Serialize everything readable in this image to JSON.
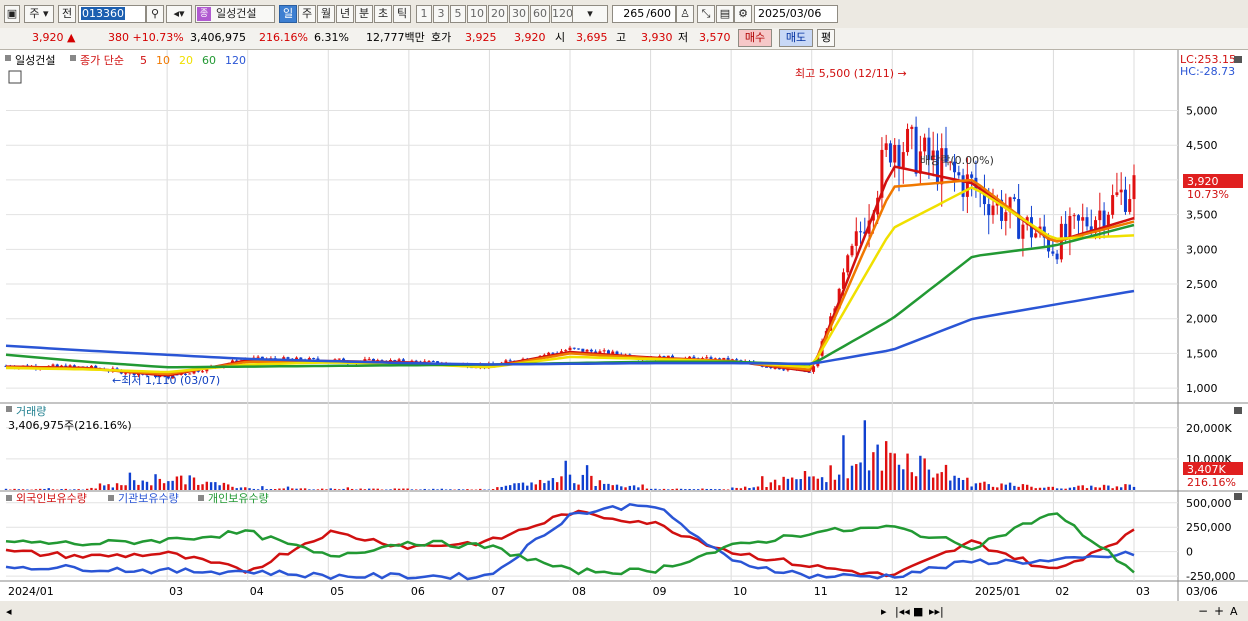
{
  "toolbar": {
    "type1": "주",
    "type2": "전",
    "code": "013360",
    "stock_name": "일성건설",
    "periods": [
      {
        "label": "일",
        "active": true
      },
      {
        "label": "주",
        "active": false
      },
      {
        "label": "월",
        "active": false
      },
      {
        "label": "년",
        "active": false
      },
      {
        "label": "분",
        "active": false
      },
      {
        "label": "초",
        "active": false
      },
      {
        "label": "틱",
        "active": false
      }
    ],
    "intervals": [
      "1",
      "3",
      "5",
      "10",
      "20",
      "30",
      "60",
      "120"
    ],
    "count": "265",
    "count_total": "/600",
    "date": "2025/03/06"
  },
  "quote": {
    "price": "3,920 ▲",
    "change": "380 +10.73%",
    "volume": "3,406,975",
    "vol_ratio": "216.16%",
    "turnover": "6.31%",
    "amount": "12,777백만",
    "hoga_label": "호가",
    "ask": "3,925",
    "bid": "3,920",
    "open_label": "시",
    "open": "3,695",
    "high_label": "고",
    "high": "3,930",
    "low_label": "저",
    "low": "3,570",
    "buy_btn": "매수",
    "sell_btn": "매도",
    "eval_btn": "평"
  },
  "price_panel": {
    "stock_label": "일성건설",
    "ma_label": "종가 단순",
    "ma_periods": [
      "5",
      "10",
      "20",
      "60",
      "120"
    ],
    "ma_colors": [
      "#d01010",
      "#f07800",
      "#f0e000",
      "#229933",
      "#2a55d5"
    ],
    "lc": "LC:253.15",
    "hc": "HC:-28.73",
    "high_annotation": "최고 5,500 (12/11) →",
    "low_annotation": "←최저 1,110 (03/07)",
    "ex_annotation": "배당락(0.00%)",
    "current_price": "3,920",
    "current_change": "10.73%"
  },
  "volume_panel": {
    "title": "거래량",
    "value": "3,406,975주(216.16%)",
    "current": "3,407K",
    "current_ratio": "216.16%"
  },
  "holding_panel": {
    "series": [
      {
        "name": "외국인보유수량",
        "color": "#d01010"
      },
      {
        "name": "기관보유수량",
        "color": "#2a55d5"
      },
      {
        "name": "개인보유수량",
        "color": "#229933"
      }
    ]
  },
  "xaxis": {
    "labels": [
      "2024/01",
      "03",
      "04",
      "05",
      "06",
      "07",
      "08",
      "09",
      "10",
      "11",
      "12",
      "2025/01",
      "02",
      "03"
    ],
    "end_label": "03/06"
  },
  "chart_data": [
    {
      "type": "candlestick",
      "title": "일성건설",
      "ylim": [
        800,
        5800
      ],
      "yticks": [
        1000,
        1500,
        2000,
        2500,
        3000,
        3500,
        4000,
        4500,
        5000
      ],
      "grid": true,
      "x": [
        "2024-01",
        "2024-02",
        "2024-03",
        "2024-04",
        "2024-05",
        "2024-06",
        "2024-07",
        "2024-08",
        "2024-09",
        "2024-10",
        "2024-11",
        "2024-12",
        "2025-01",
        "2025-02",
        "2025-03"
      ],
      "series": [
        {
          "name": "close",
          "values": [
            1320,
            1300,
            1160,
            1420,
            1400,
            1380,
            1320,
            1560,
            1440,
            1400,
            1220,
            4600,
            3900,
            3050,
            3920
          ]
        },
        {
          "name": "5",
          "values": [
            1310,
            1290,
            1180,
            1400,
            1390,
            1370,
            1310,
            1520,
            1440,
            1390,
            1240,
            4200,
            3950,
            3100,
            3450
          ]
        },
        {
          "name": "10",
          "values": [
            1300,
            1280,
            1200,
            1380,
            1380,
            1360,
            1300,
            1500,
            1430,
            1390,
            1260,
            3900,
            4000,
            3100,
            3400
          ]
        },
        {
          "name": "20",
          "values": [
            1290,
            1270,
            1230,
            1340,
            1370,
            1350,
            1300,
            1450,
            1420,
            1380,
            1300,
            3300,
            3900,
            3150,
            3200
          ]
        },
        {
          "name": "60",
          "values": [
            1480,
            1380,
            1300,
            1310,
            1320,
            1330,
            1340,
            1360,
            1380,
            1380,
            1340,
            2000,
            2900,
            3050,
            3350
          ]
        },
        {
          "name": "120",
          "values": [
            1610,
            1540,
            1480,
            1420,
            1390,
            1360,
            1340,
            1350,
            1360,
            1360,
            1350,
            1550,
            2000,
            2200,
            2400
          ]
        }
      ],
      "annotations": [
        {
          "text": "최고 5,500 (12/11)",
          "value": 5500
        },
        {
          "text": "최저 1,110 (03/07)",
          "value": 1110
        }
      ]
    },
    {
      "type": "bar",
      "title": "거래량",
      "ylim": [
        0,
        27000
      ],
      "yticks_labels": [
        "10,000K",
        "20,000K"
      ],
      "x": [
        "2024-01",
        "2024-02",
        "2024-03",
        "2024-04",
        "2024-05",
        "2024-06",
        "2024-07",
        "2024-08",
        "2024-09",
        "2024-10",
        "2024-11",
        "2024-12",
        "2025-01",
        "2025-02",
        "2025-03"
      ],
      "values": [
        600,
        500,
        9000,
        1200,
        800,
        700,
        500,
        9000,
        800,
        600,
        9500,
        26000,
        5000,
        1500,
        3407
      ]
    },
    {
      "type": "line",
      "title": "보유수량",
      "ylim": [
        -300000,
        600000
      ],
      "yticks_labels": [
        "500,000",
        "250,000",
        "0",
        "-250,000"
      ],
      "x": [
        "2024-01",
        "2024-02",
        "2024-03",
        "2024-04",
        "2024-05",
        "2024-06",
        "2024-07",
        "2024-08",
        "2024-09",
        "2024-10",
        "2024-11",
        "2024-12",
        "2025-01",
        "2025-02",
        "2025-03"
      ],
      "series": [
        {
          "name": "외국인보유수량",
          "values": [
            0,
            -50000,
            -20000,
            -200000,
            200000,
            50000,
            100000,
            400000,
            300000,
            0,
            -150000,
            -250000,
            100000,
            -200000,
            200000
          ]
        },
        {
          "name": "기관보유수량",
          "values": [
            -150000,
            -170000,
            -200000,
            -200000,
            -250000,
            -250000,
            -250000,
            380000,
            500000,
            -100000,
            -250000,
            -250000,
            -100000,
            -100000,
            -20000
          ]
        },
        {
          "name": "개인보유수량",
          "values": [
            100000,
            80000,
            120000,
            200000,
            -50000,
            100000,
            50000,
            -200000,
            -200000,
            50000,
            200000,
            250000,
            50000,
            400000,
            -200000
          ]
        }
      ]
    }
  ]
}
